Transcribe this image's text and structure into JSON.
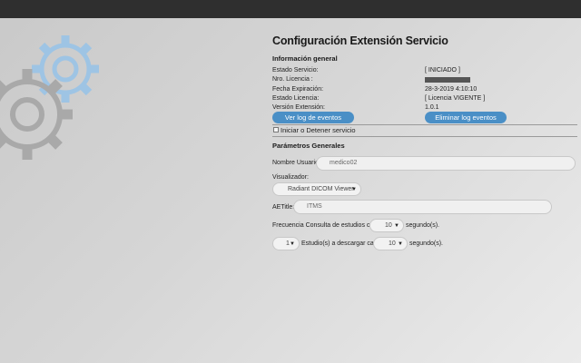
{
  "title": "Configuración Extensión Servicio",
  "general": {
    "heading": "Información general",
    "rows": [
      {
        "label": "Estado Servicio:",
        "value": "[ INICIADO ]"
      },
      {
        "label": "Nro. Licencia :",
        "value": ""
      },
      {
        "label": "Fecha Expiración:",
        "value": "28-3-2019 4:10:10"
      },
      {
        "label": "Estado Licencia:",
        "value": "[ Licencia VIGENTE ]"
      },
      {
        "label": "Versión Extensión:",
        "value": "1.0.1"
      }
    ],
    "view_log_label": "Ver log de eventos",
    "delete_log_label": "Eliminar log eventos",
    "toggle_service_label": "Iniciar o Detener servicio"
  },
  "params": {
    "heading": "Parámetros Generales",
    "username_label": "Nombre Usuario:",
    "username_value": "medico02",
    "viewer_label": "Visualizador:",
    "viewer_value": "Radiant DICOM Viewer",
    "aetitle_label": "AETitle:",
    "aetitle_value": "ITMS",
    "freq_label": "Frecuencia Consulta de estudios cada",
    "freq_value": "10",
    "freq_unit": "segundo(s).",
    "studies_value": "1",
    "studies_label": "Estudio(s) a descargar cada",
    "studies_every_value": "10",
    "studies_unit": "segundo(s)."
  },
  "colors": {
    "button": "#4a8fc6",
    "topbar": "#2f2f2f",
    "gear_blue": "#9ec4e4",
    "gear_gray": "#a9a9a9"
  },
  "icons": {
    "gears": "gears-icon",
    "dropdown": "chevron-down-icon"
  }
}
